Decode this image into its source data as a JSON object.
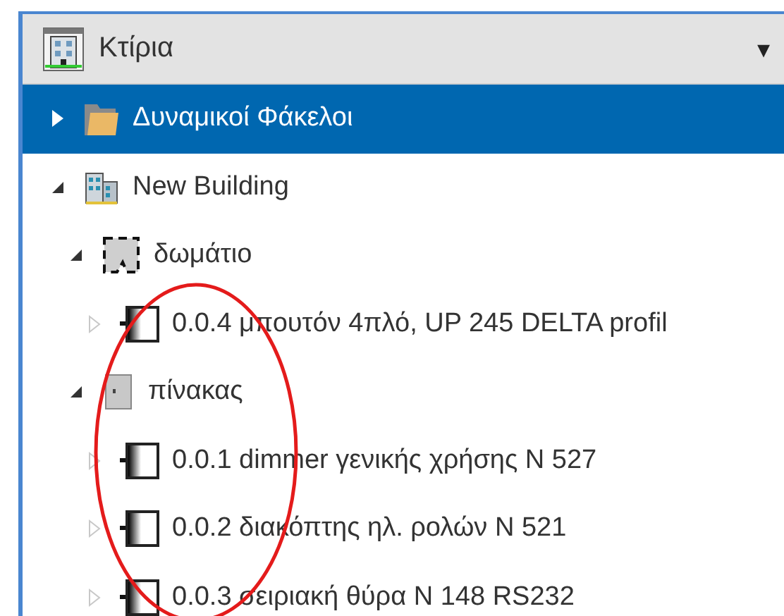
{
  "panel": {
    "title": "Κτίρια",
    "dropdown": "▾"
  },
  "tree": [
    {
      "label": "Δυναμικοί Φάκελοι",
      "kind": "folder",
      "selected": true,
      "expanded": false
    },
    {
      "label": "New Building",
      "kind": "building",
      "selected": false,
      "expanded": true,
      "children": [
        {
          "label": "δωμάτιο",
          "kind": "room",
          "selected": false,
          "expanded": true,
          "children": [
            {
              "label": "0.0.4 μπουτόν 4πλό, UP 245 DELTA profil",
              "kind": "device",
              "selected": false,
              "expanded": false
            }
          ]
        },
        {
          "label": "πίνακας",
          "kind": "cabinet",
          "selected": false,
          "expanded": true,
          "children": [
            {
              "label": "0.0.1 dimmer γενικής χρήσης N 527",
              "kind": "device",
              "selected": false,
              "expanded": false
            },
            {
              "label": "0.0.2 διακόπτης ηλ. ρολών N 521",
              "kind": "device",
              "selected": false,
              "expanded": false
            },
            {
              "label": "0.0.3 σειριακή θύρα N 148 RS232",
              "kind": "device",
              "selected": false,
              "expanded": false
            }
          ]
        }
      ]
    }
  ],
  "annotation": {
    "kind": "ellipse"
  }
}
